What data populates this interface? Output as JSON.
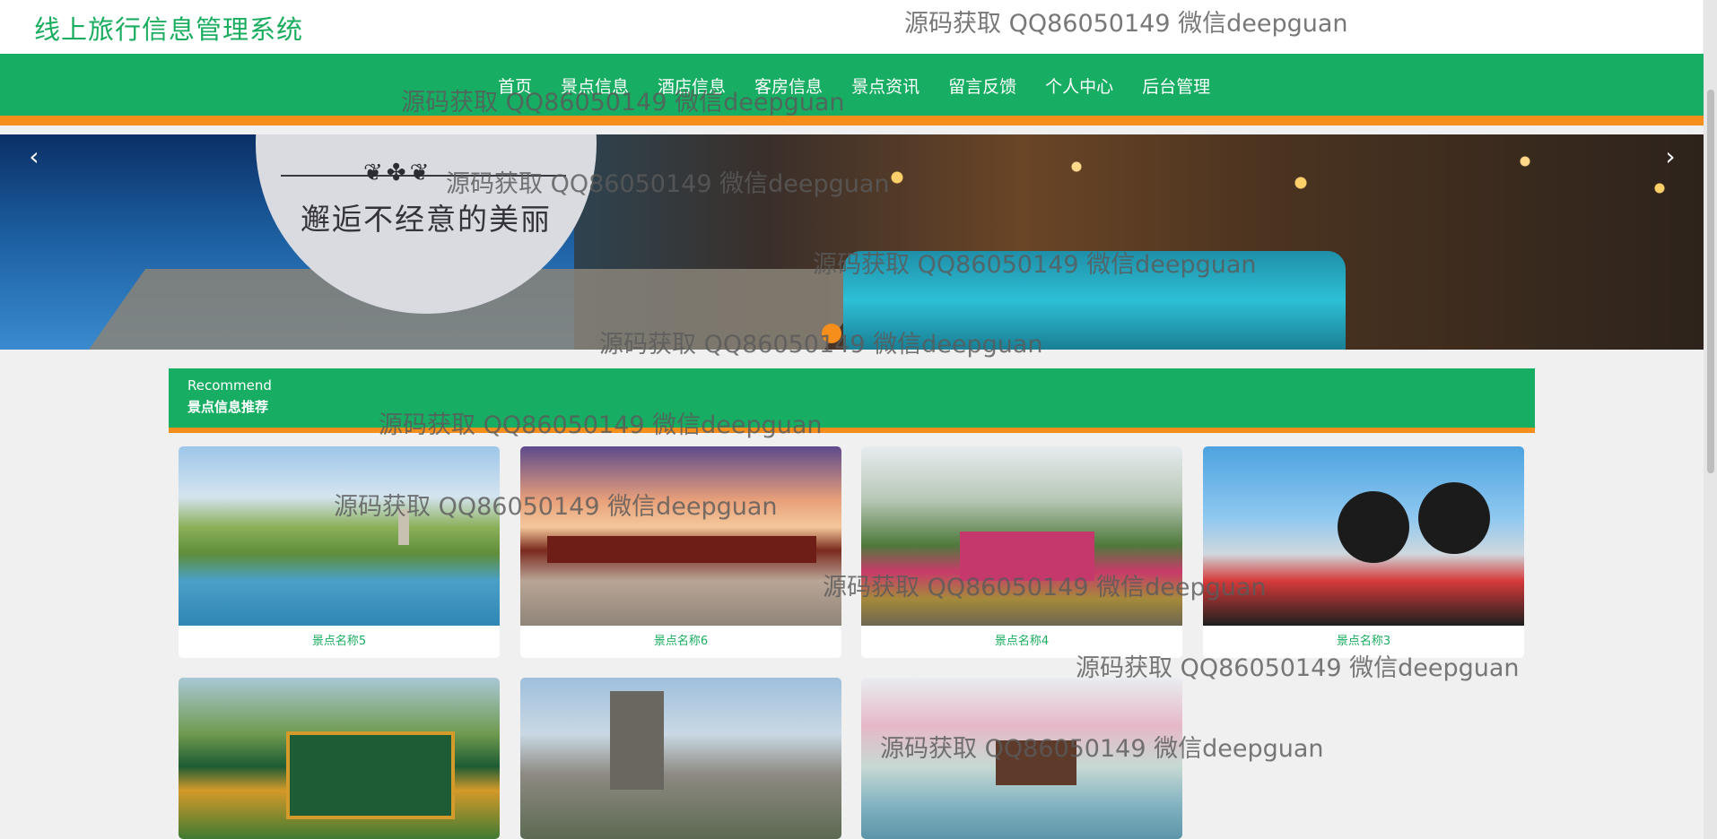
{
  "header": {
    "site_title": "线上旅行信息管理系统"
  },
  "nav": {
    "items": [
      {
        "label": "首页"
      },
      {
        "label": "景点信息"
      },
      {
        "label": "酒店信息"
      },
      {
        "label": "客房信息"
      },
      {
        "label": "景点资讯"
      },
      {
        "label": "留言反馈"
      },
      {
        "label": "个人中心"
      },
      {
        "label": "后台管理"
      }
    ]
  },
  "banner": {
    "ornament": "❦✤❦",
    "caption": "邂逅不经意的美丽",
    "prev_icon": "‹",
    "next_icon": "›"
  },
  "section": {
    "en": "Recommend",
    "zh": "景点信息推荐"
  },
  "cards": [
    {
      "name": "景点名称5"
    },
    {
      "name": "景点名称6"
    },
    {
      "name": "景点名称4"
    },
    {
      "name": "景点名称3"
    },
    {
      "name": ""
    },
    {
      "name": ""
    },
    {
      "name": ""
    }
  ],
  "watermark": "源码获取 QQ86050149 微信deepguan",
  "colors": {
    "primary": "#17ad62",
    "accent": "#f68e1c",
    "title": "#1aad5f"
  }
}
